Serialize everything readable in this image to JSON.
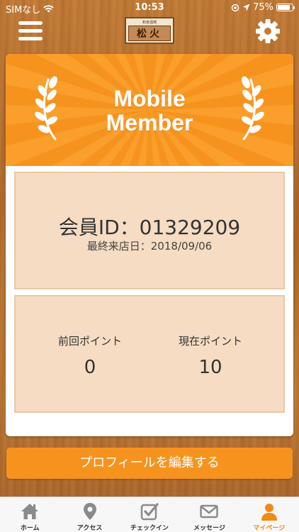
{
  "status_bar": {
    "carrier": "SIMなし",
    "time": "10:53",
    "battery": "75%"
  },
  "nav": {
    "logo_text": "松火",
    "logo_small": "和食酒場"
  },
  "card": {
    "title_line1": "Mobile",
    "title_line2": "Member",
    "member_id": "会員ID：01329209",
    "last_visit": "最終来店日：2018/09/06",
    "prev_points_label": "前回ポイント",
    "prev_points_value": "0",
    "curr_points_label": "現在ポイント",
    "curr_points_value": "10"
  },
  "edit_profile_label": "プロフィールを編集する",
  "tabs": [
    {
      "label": "ホーム",
      "icon": "home-icon"
    },
    {
      "label": "アクセス",
      "icon": "map-pin-icon"
    },
    {
      "label": "チェックイン",
      "icon": "checkin-icon"
    },
    {
      "label": "メッセージ",
      "icon": "message-icon"
    },
    {
      "label": "マイページ",
      "icon": "user-icon"
    }
  ],
  "colors": {
    "accent": "#f6931e",
    "panel": "#f5dcc2",
    "tab_active": "#f08a14",
    "tab_inactive": "#8a8a8a"
  }
}
